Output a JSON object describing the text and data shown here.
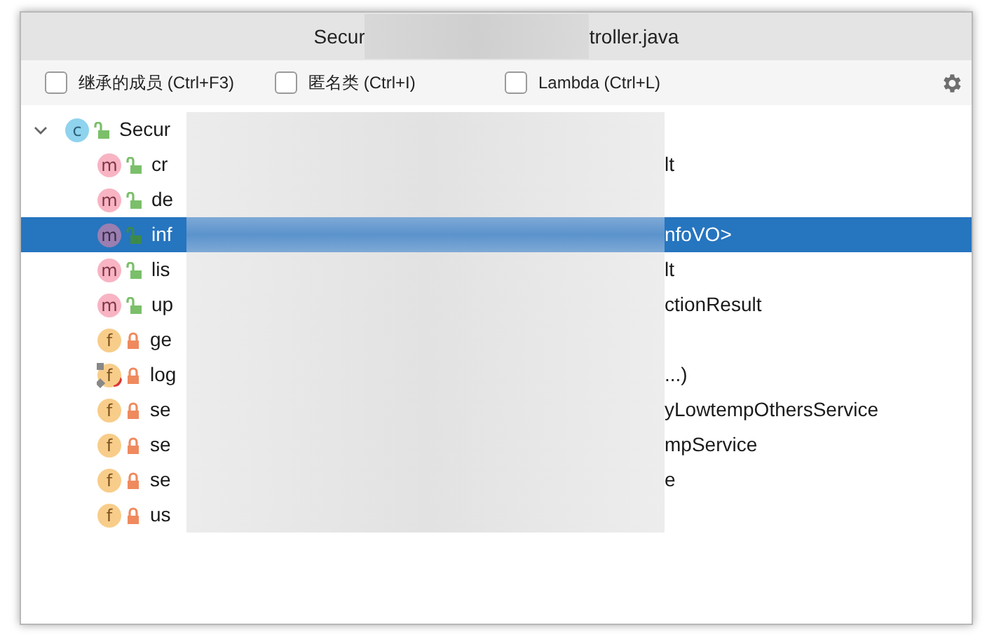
{
  "window": {
    "title_start": "Secur",
    "title_end": "troller.java"
  },
  "filters": [
    {
      "label": "继承的成员 (Ctrl+F3)",
      "checked": false
    },
    {
      "label": "匿名类 (Ctrl+I)",
      "checked": false
    },
    {
      "label": "Lambda (Ctrl+L)",
      "checked": false
    }
  ],
  "tree": {
    "root": {
      "kind": "class",
      "icon_letter": "c",
      "locked": false,
      "expanded": true,
      "selected": false,
      "text_start": "Secur",
      "children": [
        {
          "kind": "method",
          "icon_letter": "m",
          "locked": false,
          "selected": false,
          "text_start": "cr",
          "text_end": "lt"
        },
        {
          "kind": "method",
          "icon_letter": "m",
          "locked": false,
          "selected": false,
          "text_start": "de"
        },
        {
          "kind": "method",
          "icon_letter": "m",
          "locked": false,
          "selected": true,
          "text_start": "inf",
          "text_end": "nfoVO>"
        },
        {
          "kind": "method",
          "icon_letter": "m",
          "locked": false,
          "selected": false,
          "text_start": "lis",
          "text_end": "lt"
        },
        {
          "kind": "method",
          "icon_letter": "m",
          "locked": false,
          "selected": false,
          "text_start": "up",
          "text_end": "ctionResult"
        },
        {
          "kind": "field",
          "icon_letter": "f",
          "locked": true,
          "selected": false,
          "text_start": "ge"
        },
        {
          "kind": "field",
          "icon_letter": "f",
          "locked": true,
          "decorated": true,
          "selected": false,
          "text_start": "log",
          "text_end": "...)"
        },
        {
          "kind": "field",
          "icon_letter": "f",
          "locked": true,
          "selected": false,
          "text_start": "se",
          "text_end": "yLowtempOthersService"
        },
        {
          "kind": "field",
          "icon_letter": "f",
          "locked": true,
          "selected": false,
          "text_start": "se",
          "text_end": "mpService"
        },
        {
          "kind": "field",
          "icon_letter": "f",
          "locked": true,
          "selected": false,
          "text_start": "se",
          "text_end": "e"
        },
        {
          "kind": "field",
          "icon_letter": "f",
          "locked": true,
          "selected": false,
          "text_start": "us"
        }
      ]
    }
  }
}
